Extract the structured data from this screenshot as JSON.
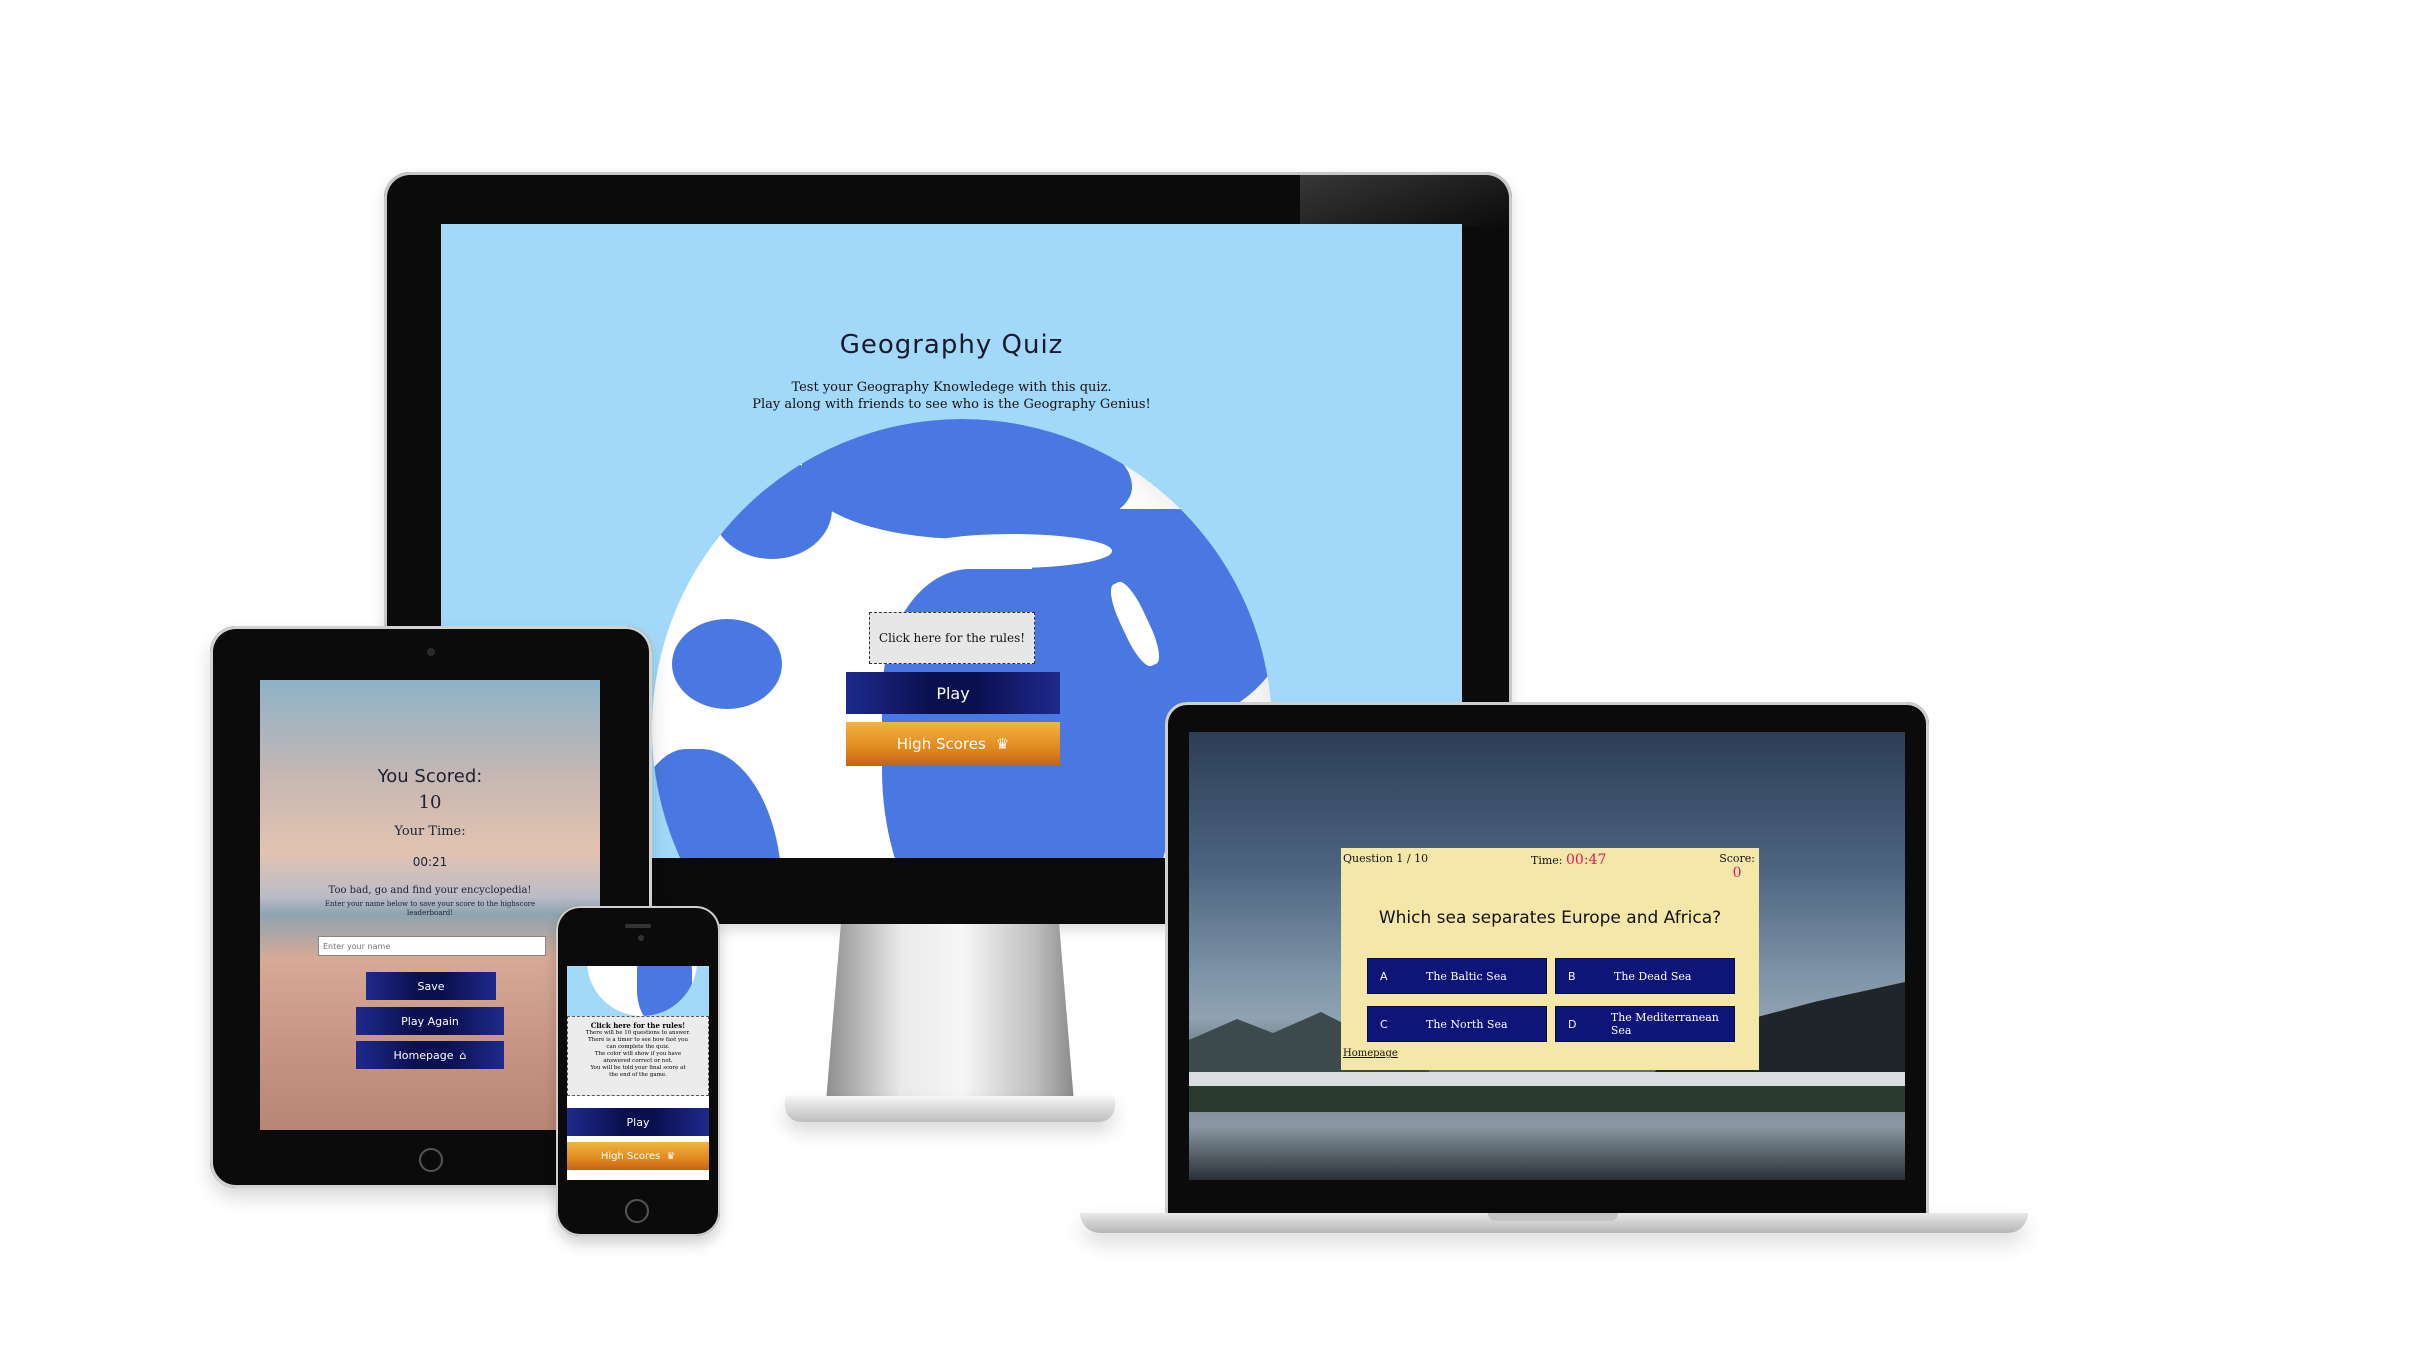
{
  "desktop": {
    "title": "Geography Quiz",
    "subtitle_line1": "Test your Geography Knowledege with this quiz.",
    "subtitle_line2": "Play along with friends to see who is the Geography Genius!",
    "rules_button": "Click here for the rules!",
    "play_button": "Play",
    "high_scores_button": "High Scores",
    "crown_icon": "♛",
    "bg_color": "#a3d9f8",
    "land_color": "#4a78e2"
  },
  "tablet": {
    "scored_label": "You Scored:",
    "score_value": "10",
    "time_label": "Your Time:",
    "time_value": "00:21",
    "message": "Too bad, go and find your encyclopedia!",
    "instructions": "Enter your name below to save your score to the highscore leaderboard!",
    "name_placeholder": "Enter your name",
    "save_button": "Save",
    "play_again_button": "Play Again",
    "homepage_button": "Homepage",
    "home_icon": "⌂"
  },
  "phone": {
    "rules_heading": "Click here for the rules!",
    "rules_text": [
      "There will be 10 questions to answer.",
      "There is a timer to see how fast you",
      "can complete the quiz.",
      "The color will show if you have",
      "answered correct or not.",
      "You will be told your final score at",
      "the end of the game."
    ],
    "play_button": "Play",
    "high_scores_button": "High Scores",
    "crown_icon": "♛"
  },
  "laptop": {
    "question_counter": "Question 1 / 10",
    "time_label": "Time:",
    "time_value": "00:47",
    "score_label": "Score:",
    "score_value": "0",
    "question": "Which sea separates Europe and Africa?",
    "answers": [
      {
        "letter": "A",
        "text": "The Baltic Sea"
      },
      {
        "letter": "B",
        "text": "The Dead Sea"
      },
      {
        "letter": "C",
        "text": "The North Sea"
      },
      {
        "letter": "D",
        "text": "The Mediterranean Sea"
      }
    ],
    "homepage_link": "Homepage",
    "accent_color": "#e2175f",
    "card_color": "#f5e7a8"
  }
}
